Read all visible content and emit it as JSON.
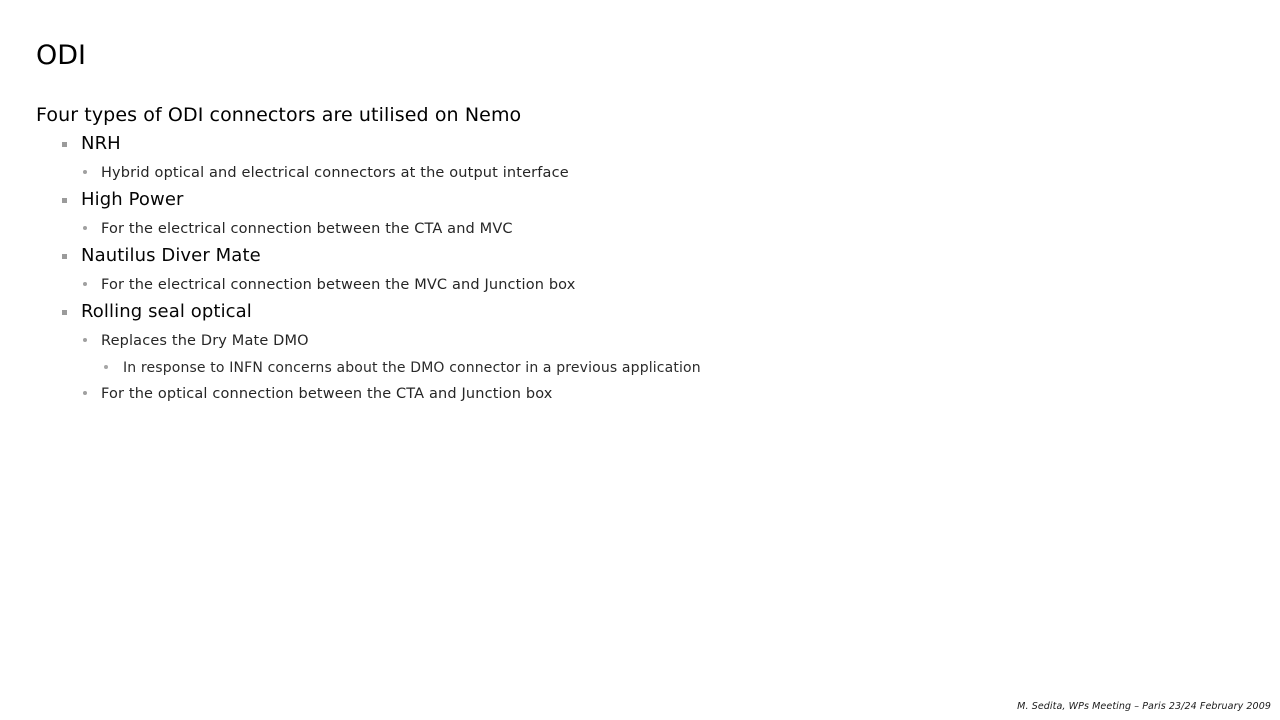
{
  "slide": {
    "title": "ODI",
    "intro": "Four types of ODI connectors are utilised on Nemo",
    "bullets": [
      {
        "level": 2,
        "text": "NRH",
        "marker": "square-bullet"
      },
      {
        "level": 3,
        "text": "Hybrid optical and electrical connectors at the output interface",
        "marker": "dot-bullet"
      },
      {
        "level": 2,
        "text": "High Power",
        "marker": "square-bullet"
      },
      {
        "level": 3,
        "text": "For the electrical connection between the CTA and MVC",
        "marker": "dot-bullet"
      },
      {
        "level": 2,
        "text": "Nautilus Diver Mate",
        "marker": "square-bullet"
      },
      {
        "level": 3,
        "text": "For the electrical connection between the MVC and Junction box",
        "marker": "dot-bullet"
      },
      {
        "level": 2,
        "text": "Rolling seal optical",
        "marker": "square-bullet"
      },
      {
        "level": 3,
        "text": "Replaces the Dry Mate DMO",
        "marker": "dot-bullet"
      },
      {
        "level": 4,
        "text": "In response to INFN concerns about the DMO connector in a previous application",
        "marker": "dot-bullet"
      },
      {
        "level": 3,
        "text": "For the optical connection between the CTA and Junction box",
        "marker": "dot-bullet"
      }
    ],
    "footer": "M. Sedita, WPs Meeting – Paris 23/24 February 2009"
  },
  "colors": {
    "background": "#ffffff",
    "title_text": "#000000",
    "body_text": "#000000",
    "sub_text": "#262626",
    "bullet_marker": "#9b9b9b",
    "footer_text": "#1a1a1a"
  }
}
